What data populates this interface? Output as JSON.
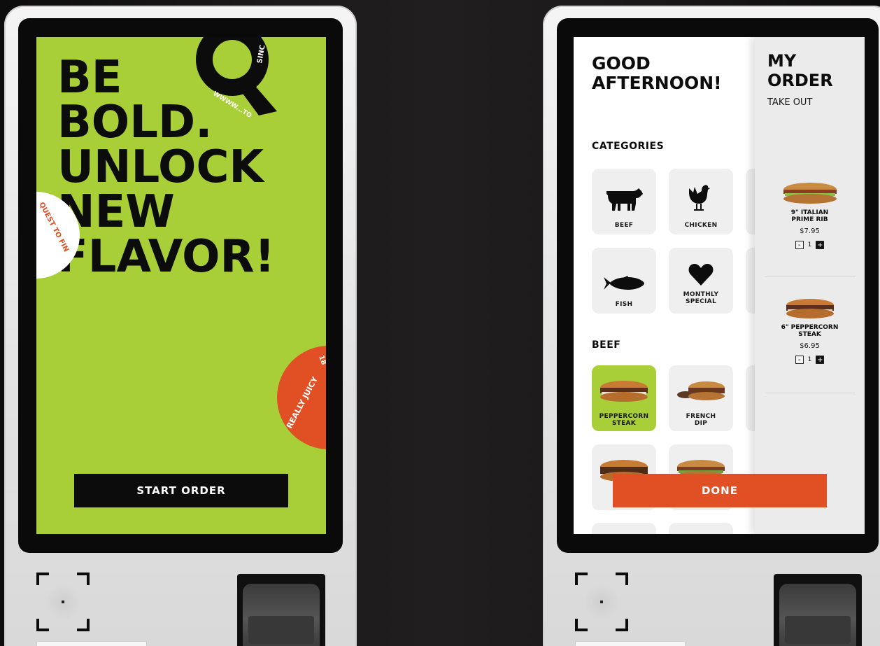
{
  "left_kiosk": {
    "headline": [
      "BE",
      "BOLD.",
      "UNLOCK",
      "NEW",
      "FLAVOR!"
    ],
    "q_badge_text": "WWWW...TO",
    "q_badge_text_2": "SINC",
    "white_badge_text": "QUEST TO FIN",
    "orange_badge_text": "REALLY JUICY",
    "orange_badge_text_2": "18",
    "start_button": "START ORDER"
  },
  "right_kiosk": {
    "greeting": [
      "GOOD",
      "AFTERNOON!"
    ],
    "categories_title": "CATEGORIES",
    "categories": [
      {
        "label": "BEEF",
        "icon": "cow-icon"
      },
      {
        "label": "CHICKEN",
        "icon": "chicken-icon"
      },
      {
        "label": "FISH",
        "icon": "fish-icon"
      },
      {
        "label": "MONTHLY\nSPECIAL",
        "icon": "heart-icon"
      }
    ],
    "beef_title": "BEEF",
    "beef_items": [
      {
        "label": "PEPPERCORN\nSTEAK",
        "selected": true
      },
      {
        "label": "FRENCH\nDIP",
        "selected": false
      }
    ],
    "order": {
      "title": [
        "MY",
        "ORDER"
      ],
      "type": "TAKE OUT",
      "items": [
        {
          "name": "9\" ITALIAN\nPRIME RIB",
          "price": "$7.95",
          "qty": "1"
        },
        {
          "name": "6\" PEPPERCORN\nSTEAK",
          "price": "$6.95",
          "qty": "1"
        }
      ]
    },
    "done_button": "DONE"
  },
  "colors": {
    "lime": "#a8ce38",
    "orange": "#e05024",
    "black": "#0c0c0c"
  }
}
